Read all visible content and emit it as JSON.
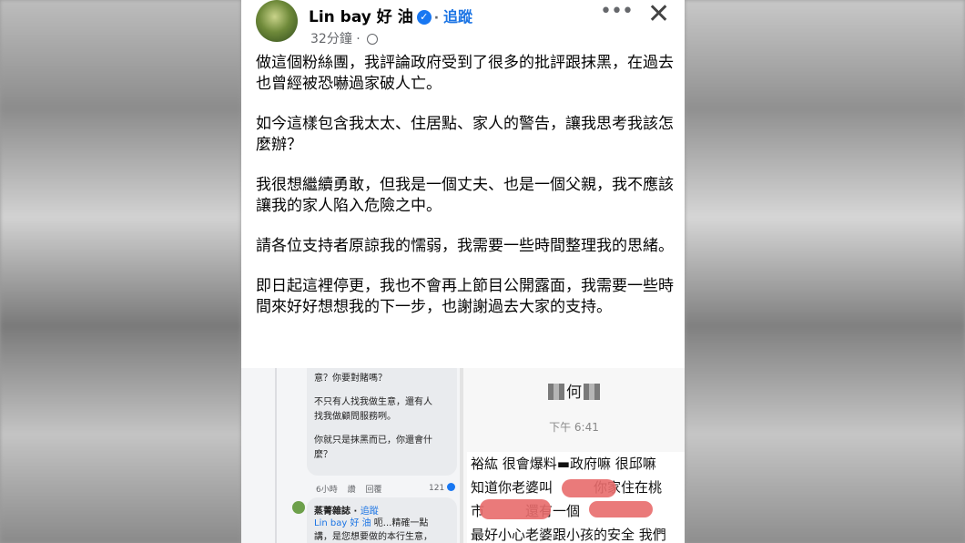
{
  "post": {
    "author": "Lin bay 好 油",
    "follow_label": "追蹤",
    "time": "32分鐘",
    "more_icon": "more-icon",
    "close_icon": "close-icon",
    "paragraphs": [
      "做這個粉絲團，我評論政府受到了很多的批評跟抹黑，在過去也曾經被恐嚇過家破人亡。",
      "如今這樣包含我太太、住居點、家人的警告，讓我思考我該怎麼辦？",
      "我很想繼續勇敢，但我是一個丈夫、也是一個父親，我不應該讓我的家人陷入危險之中。",
      "請各位支持者原諒我的懦弱，我需要一些時間整理我的思緒。",
      "即日起這裡停更，我也不會再上節目公開露面，我需要一些時間來好好想想我的下一步，也謝謝過去大家的支持。"
    ]
  },
  "left_screenshot": {
    "comment1_lines": [
      "意？你要對賭嗎？",
      "",
      "不只有人找我做生意，還有人",
      "找我做顧問服務咧。",
      "",
      "你就只是抹黑而已，你還會什",
      "麼？"
    ],
    "comment1_time": "6小時",
    "comment1_reply_action": "讚",
    "comment1_reply": "回覆",
    "comment1_likes": "121",
    "comment2_author": "蒸菁雜誌",
    "comment2_follow": "追蹤",
    "comment2_mention": "Lin bay 好 油",
    "comment2_line1": " 呃...精確一點",
    "comment2_line2": "講，是您想要做的本行生意，"
  },
  "right_screenshot": {
    "name": "何",
    "time": "下午 6:41",
    "lines": [
      "裕紘 很會爆料▬政府嘛 很邱嘛",
      "知道你老婆叫　　　你家住在桃",
      "市　　　還有一個",
      "最好小心老婆跟小孩的安全 我們"
    ]
  },
  "colors": {
    "link": "#1b74e4",
    "verified": "#1877f2",
    "redaction": "#e86b6b"
  }
}
